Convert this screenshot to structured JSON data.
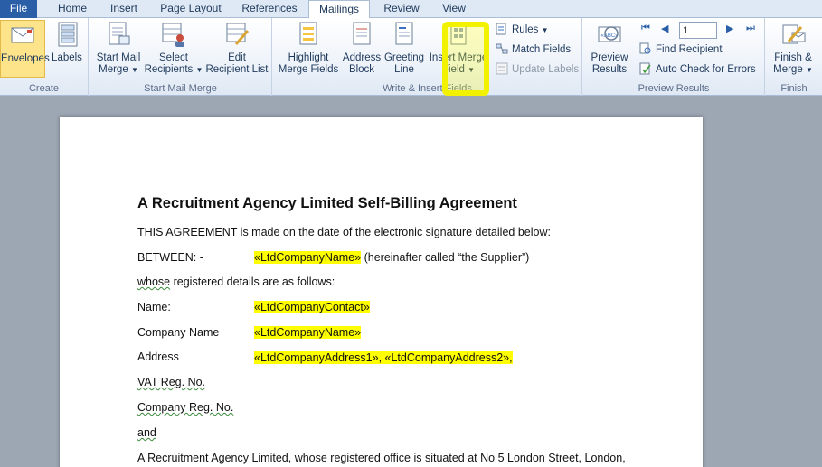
{
  "tabs": [
    "File",
    "Home",
    "Insert",
    "Page Layout",
    "References",
    "Mailings",
    "Review",
    "View"
  ],
  "ribbon": {
    "create": {
      "label": "Create",
      "envelopes": "Envelopes",
      "labels": "Labels"
    },
    "start": {
      "label": "Start Mail Merge",
      "start_mail_merge_1": "Start Mail",
      "start_mail_merge_2": "Merge",
      "select_recipients_1": "Select",
      "select_recipients_2": "Recipients",
      "edit_recipient_1": "Edit",
      "edit_recipient_2": "Recipient List"
    },
    "write": {
      "label": "Write & Insert Fields",
      "highlight_1": "Highlight",
      "highlight_2": "Merge Fields",
      "address_1": "Address",
      "address_2": "Block",
      "greeting_1": "Greeting",
      "greeting_2": "Line",
      "insert_1": "Insert Merge",
      "insert_2": "Field",
      "rules": "Rules",
      "match": "Match Fields",
      "update": "Update Labels"
    },
    "preview": {
      "label": "Preview Results",
      "preview_1": "Preview",
      "preview_2": "Results",
      "record": "1",
      "find": "Find Recipient",
      "auto": "Auto Check for Errors"
    },
    "finish": {
      "label": "Finish",
      "finish_1": "Finish &",
      "finish_2": "Merge"
    }
  },
  "document": {
    "title": "A Recruitment Agency Limited Self-Billing Agreement",
    "line1": "THIS AGREEMENT is made on the date of the electronic signature detailed below:",
    "between_label": "BETWEEN: -",
    "field_company_name": "«LtdCompanyName»",
    "supplier_text": " (hereinafter called “the Supplier”)",
    "whose_word": "whose",
    "whose_rest": " registered details are as follows:",
    "name_label": "Name:",
    "field_contact": "«LtdCompanyContact»",
    "company_label": "Company Name",
    "field_company_name2": "«LtdCompanyName»",
    "address_label": "Address",
    "field_address": "«LtdCompanyAddress1», «LtdCompanyAddress2»,",
    "vat_label": "VAT Reg. No.",
    "company_reg_label": "Company Reg. No.",
    "and_label": "and",
    "last_line": "A Recruitment Agency Limited, whose registered office is situated at No 5 London Street, London,"
  }
}
